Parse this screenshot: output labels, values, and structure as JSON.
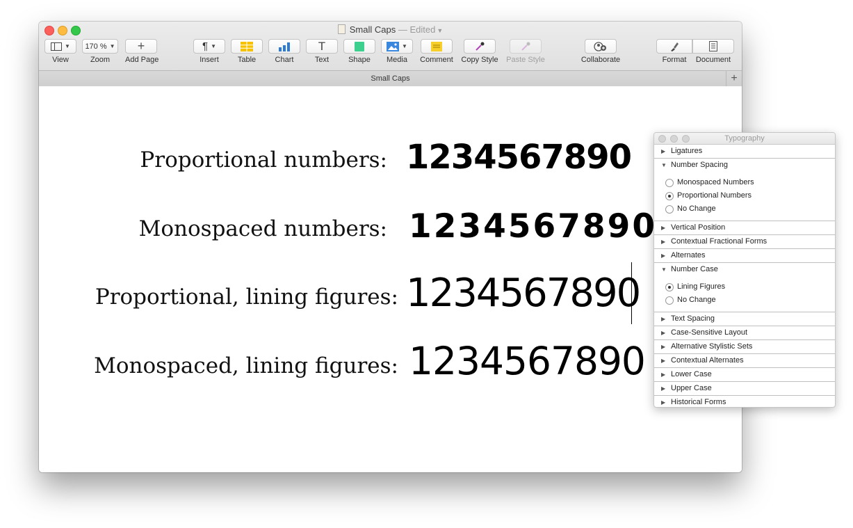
{
  "window": {
    "title": "Small Caps",
    "title_status": "— Edited",
    "tab_title": "Small Caps"
  },
  "toolbar": {
    "view": {
      "label": "View"
    },
    "zoom": {
      "label": "Zoom",
      "value": "170 %"
    },
    "add_page": {
      "label": "Add Page"
    },
    "insert": {
      "label": "Insert"
    },
    "table": {
      "label": "Table"
    },
    "chart": {
      "label": "Chart"
    },
    "text": {
      "label": "Text"
    },
    "shape": {
      "label": "Shape"
    },
    "media": {
      "label": "Media"
    },
    "comment": {
      "label": "Comment"
    },
    "copy_style": {
      "label": "Copy Style"
    },
    "paste_style": {
      "label": "Paste Style"
    },
    "collaborate": {
      "label": "Collaborate"
    },
    "format": {
      "label": "Format"
    },
    "document": {
      "label": "Document"
    }
  },
  "document": {
    "rows": [
      {
        "label": "Proportional numbers:",
        "numbers": "1234567890"
      },
      {
        "label": "Monospaced numbers:",
        "numbers": "1234567890"
      },
      {
        "label": "Proportional, lining figures:",
        "numbers": "1234567890"
      },
      {
        "label": "Monospaced, lining figures:",
        "numbers": "1234567890"
      }
    ]
  },
  "typography_panel": {
    "title": "Typography",
    "sections": {
      "ligatures": "Ligatures",
      "number_spacing": "Number Spacing",
      "vertical_position": "Vertical Position",
      "contextual_fractional_forms": "Contextual Fractional Forms",
      "alternates": "Alternates",
      "number_case": "Number Case",
      "text_spacing": "Text Spacing",
      "case_sensitive_layout": "Case-Sensitive Layout",
      "alternative_stylistic_sets": "Alternative Stylistic Sets",
      "contextual_alternates": "Contextual Alternates",
      "lower_case": "Lower Case",
      "upper_case": "Upper Case",
      "historical_forms": "Historical Forms"
    },
    "number_spacing_options": [
      "Monospaced Numbers",
      "Proportional Numbers",
      "No Change"
    ],
    "number_spacing_selected": "Proportional Numbers",
    "number_case_options": [
      "Lining Figures",
      "No Change"
    ],
    "number_case_selected": "Lining Figures"
  },
  "colors": {
    "close": "#fc605c",
    "minimize": "#fdbc40",
    "maximize": "#34c84a",
    "table_icon": "#f6c200",
    "chart_icon": "#2e7bd6",
    "shape_icon": "#3ccf8e",
    "comment_icon": "#f7cf2a"
  }
}
